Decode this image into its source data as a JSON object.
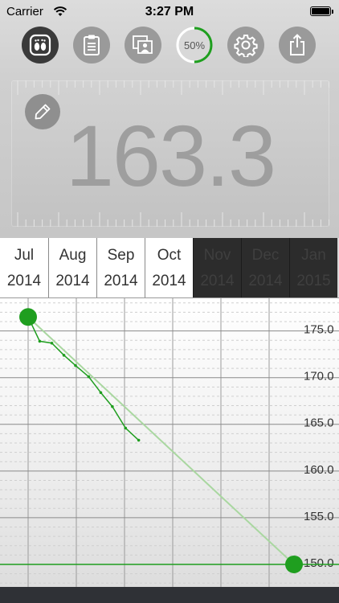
{
  "status_bar": {
    "carrier": "Carrier",
    "time": "3:27 PM"
  },
  "toolbar": {
    "buttons": [
      {
        "name": "scale-button",
        "icon": "footprints-icon",
        "active": true
      },
      {
        "name": "log-button",
        "icon": "clipboard-icon"
      },
      {
        "name": "photos-button",
        "icon": "photos-icon"
      },
      {
        "name": "goal-progress-button",
        "icon": "progress-ring",
        "label": "50%",
        "progress": 0.5
      },
      {
        "name": "settings-button",
        "icon": "gear-icon"
      },
      {
        "name": "share-button",
        "icon": "share-icon"
      }
    ]
  },
  "display": {
    "weight": "163.3",
    "edit_icon": "pencil-icon"
  },
  "months": [
    {
      "month": "Jul",
      "year": "2014",
      "state": "past"
    },
    {
      "month": "Aug",
      "year": "2014",
      "state": "past"
    },
    {
      "month": "Sep",
      "year": "2014",
      "state": "past"
    },
    {
      "month": "Oct",
      "year": "2014",
      "state": "past"
    },
    {
      "month": "Nov",
      "year": "2014",
      "state": "future"
    },
    {
      "month": "Dec",
      "year": "2014",
      "state": "future"
    },
    {
      "month": "Jan",
      "year": "2015",
      "state": "future"
    }
  ],
  "colors": {
    "accent_green": "#1f9e1f",
    "trend_line": "#a9d7a0",
    "future_month_bg": "#2c2c2c"
  },
  "chart_data": {
    "type": "line",
    "ylim": [
      147.5,
      178.5
    ],
    "y_ticks": [
      "175.0",
      "170.0",
      "165.0",
      "160.0",
      "155.0",
      "150.0"
    ],
    "goal_weight": 150.0,
    "start_point": {
      "x": 0.25,
      "y": 176.5
    },
    "goal_point": {
      "x": 5.3,
      "y": 150.0
    },
    "series": [
      {
        "x": [
          0.25,
          0.47,
          0.7,
          0.93,
          1.15,
          1.4,
          1.63,
          1.85,
          2.1,
          2.35
        ],
        "y": [
          176.5,
          173.9,
          173.7,
          172.4,
          171.3,
          170.1,
          168.4,
          166.9,
          164.6,
          163.3
        ]
      }
    ]
  }
}
